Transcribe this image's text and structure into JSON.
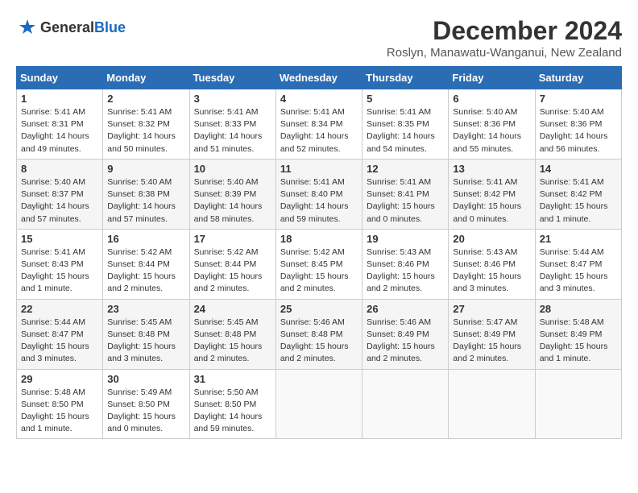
{
  "header": {
    "logo_general": "General",
    "logo_blue": "Blue",
    "month_title": "December 2024",
    "location": "Roslyn, Manawatu-Wanganui, New Zealand"
  },
  "weekdays": [
    "Sunday",
    "Monday",
    "Tuesday",
    "Wednesday",
    "Thursday",
    "Friday",
    "Saturday"
  ],
  "weeks": [
    [
      {
        "day": "1",
        "sunrise": "Sunrise: 5:41 AM",
        "sunset": "Sunset: 8:31 PM",
        "daylight": "Daylight: 14 hours and 49 minutes."
      },
      {
        "day": "2",
        "sunrise": "Sunrise: 5:41 AM",
        "sunset": "Sunset: 8:32 PM",
        "daylight": "Daylight: 14 hours and 50 minutes."
      },
      {
        "day": "3",
        "sunrise": "Sunrise: 5:41 AM",
        "sunset": "Sunset: 8:33 PM",
        "daylight": "Daylight: 14 hours and 51 minutes."
      },
      {
        "day": "4",
        "sunrise": "Sunrise: 5:41 AM",
        "sunset": "Sunset: 8:34 PM",
        "daylight": "Daylight: 14 hours and 52 minutes."
      },
      {
        "day": "5",
        "sunrise": "Sunrise: 5:41 AM",
        "sunset": "Sunset: 8:35 PM",
        "daylight": "Daylight: 14 hours and 54 minutes."
      },
      {
        "day": "6",
        "sunrise": "Sunrise: 5:40 AM",
        "sunset": "Sunset: 8:36 PM",
        "daylight": "Daylight: 14 hours and 55 minutes."
      },
      {
        "day": "7",
        "sunrise": "Sunrise: 5:40 AM",
        "sunset": "Sunset: 8:36 PM",
        "daylight": "Daylight: 14 hours and 56 minutes."
      }
    ],
    [
      {
        "day": "8",
        "sunrise": "Sunrise: 5:40 AM",
        "sunset": "Sunset: 8:37 PM",
        "daylight": "Daylight: 14 hours and 57 minutes."
      },
      {
        "day": "9",
        "sunrise": "Sunrise: 5:40 AM",
        "sunset": "Sunset: 8:38 PM",
        "daylight": "Daylight: 14 hours and 57 minutes."
      },
      {
        "day": "10",
        "sunrise": "Sunrise: 5:40 AM",
        "sunset": "Sunset: 8:39 PM",
        "daylight": "Daylight: 14 hours and 58 minutes."
      },
      {
        "day": "11",
        "sunrise": "Sunrise: 5:41 AM",
        "sunset": "Sunset: 8:40 PM",
        "daylight": "Daylight: 14 hours and 59 minutes."
      },
      {
        "day": "12",
        "sunrise": "Sunrise: 5:41 AM",
        "sunset": "Sunset: 8:41 PM",
        "daylight": "Daylight: 15 hours and 0 minutes."
      },
      {
        "day": "13",
        "sunrise": "Sunrise: 5:41 AM",
        "sunset": "Sunset: 8:42 PM",
        "daylight": "Daylight: 15 hours and 0 minutes."
      },
      {
        "day": "14",
        "sunrise": "Sunrise: 5:41 AM",
        "sunset": "Sunset: 8:42 PM",
        "daylight": "Daylight: 15 hours and 1 minute."
      }
    ],
    [
      {
        "day": "15",
        "sunrise": "Sunrise: 5:41 AM",
        "sunset": "Sunset: 8:43 PM",
        "daylight": "Daylight: 15 hours and 1 minute."
      },
      {
        "day": "16",
        "sunrise": "Sunrise: 5:42 AM",
        "sunset": "Sunset: 8:44 PM",
        "daylight": "Daylight: 15 hours and 2 minutes."
      },
      {
        "day": "17",
        "sunrise": "Sunrise: 5:42 AM",
        "sunset": "Sunset: 8:44 PM",
        "daylight": "Daylight: 15 hours and 2 minutes."
      },
      {
        "day": "18",
        "sunrise": "Sunrise: 5:42 AM",
        "sunset": "Sunset: 8:45 PM",
        "daylight": "Daylight: 15 hours and 2 minutes."
      },
      {
        "day": "19",
        "sunrise": "Sunrise: 5:43 AM",
        "sunset": "Sunset: 8:46 PM",
        "daylight": "Daylight: 15 hours and 2 minutes."
      },
      {
        "day": "20",
        "sunrise": "Sunrise: 5:43 AM",
        "sunset": "Sunset: 8:46 PM",
        "daylight": "Daylight: 15 hours and 3 minutes."
      },
      {
        "day": "21",
        "sunrise": "Sunrise: 5:44 AM",
        "sunset": "Sunset: 8:47 PM",
        "daylight": "Daylight: 15 hours and 3 minutes."
      }
    ],
    [
      {
        "day": "22",
        "sunrise": "Sunrise: 5:44 AM",
        "sunset": "Sunset: 8:47 PM",
        "daylight": "Daylight: 15 hours and 3 minutes."
      },
      {
        "day": "23",
        "sunrise": "Sunrise: 5:45 AM",
        "sunset": "Sunset: 8:48 PM",
        "daylight": "Daylight: 15 hours and 3 minutes."
      },
      {
        "day": "24",
        "sunrise": "Sunrise: 5:45 AM",
        "sunset": "Sunset: 8:48 PM",
        "daylight": "Daylight: 15 hours and 2 minutes."
      },
      {
        "day": "25",
        "sunrise": "Sunrise: 5:46 AM",
        "sunset": "Sunset: 8:48 PM",
        "daylight": "Daylight: 15 hours and 2 minutes."
      },
      {
        "day": "26",
        "sunrise": "Sunrise: 5:46 AM",
        "sunset": "Sunset: 8:49 PM",
        "daylight": "Daylight: 15 hours and 2 minutes."
      },
      {
        "day": "27",
        "sunrise": "Sunrise: 5:47 AM",
        "sunset": "Sunset: 8:49 PM",
        "daylight": "Daylight: 15 hours and 2 minutes."
      },
      {
        "day": "28",
        "sunrise": "Sunrise: 5:48 AM",
        "sunset": "Sunset: 8:49 PM",
        "daylight": "Daylight: 15 hours and 1 minute."
      }
    ],
    [
      {
        "day": "29",
        "sunrise": "Sunrise: 5:48 AM",
        "sunset": "Sunset: 8:50 PM",
        "daylight": "Daylight: 15 hours and 1 minute."
      },
      {
        "day": "30",
        "sunrise": "Sunrise: 5:49 AM",
        "sunset": "Sunset: 8:50 PM",
        "daylight": "Daylight: 15 hours and 0 minutes."
      },
      {
        "day": "31",
        "sunrise": "Sunrise: 5:50 AM",
        "sunset": "Sunset: 8:50 PM",
        "daylight": "Daylight: 14 hours and 59 minutes."
      },
      null,
      null,
      null,
      null
    ]
  ]
}
